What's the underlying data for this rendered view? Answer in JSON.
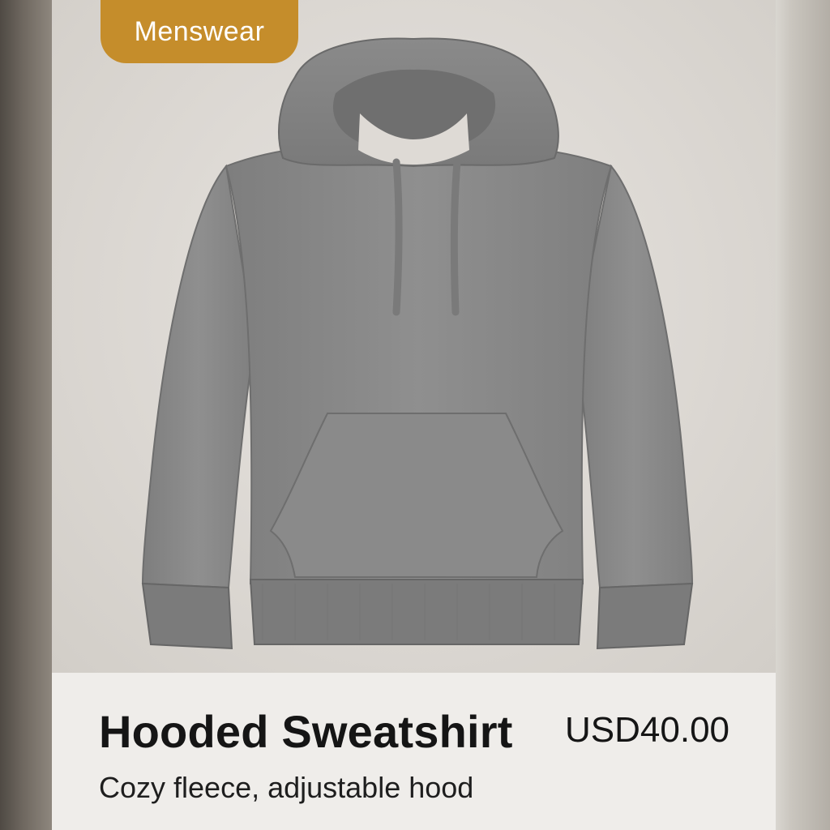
{
  "product": {
    "category_badge": "Menswear",
    "title": "Hooded Sweatshirt",
    "price": "USD40.00",
    "description": "Cozy fleece, adjustable hood",
    "image_subject": "gray-hoodie"
  },
  "colors": {
    "badge": "#c58d2b",
    "card_background": "#efedea",
    "hoodie_gray": "#8c8c8c"
  }
}
